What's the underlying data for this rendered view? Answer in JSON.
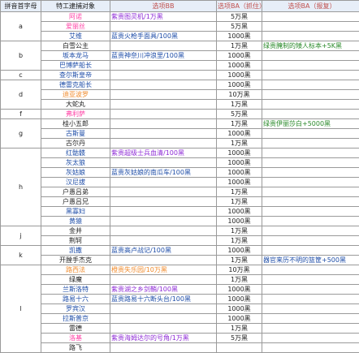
{
  "headers": {
    "letter": "拼音首字母",
    "target": "特工逮捕对象",
    "option_bb": "选项BB",
    "option_ba_catch": "选项BA（抓住）",
    "option_ba_report": "选项BA（报复）"
  },
  "rows": [
    {
      "name": "阿诺",
      "name_color": "pink",
      "bb": "紫贵图灵机/1万黑",
      "bb_color": "purple",
      "ba": "5万黑",
      "bar": "",
      "bar_color": ""
    },
    {
      "name": "爱丽丝",
      "name_color": "pink",
      "bb": "",
      "bb_color": "",
      "ba": "5万黑",
      "bar": "",
      "bar_color": ""
    },
    {
      "name": "艾维",
      "name_color": "blue",
      "bb": "蓝贵火枪手面具/100黑",
      "bb_color": "blue",
      "ba": "1000黑",
      "bar": "",
      "bar_color": ""
    },
    {
      "name": "白雪公主",
      "name_color": "dark",
      "bb": "",
      "bb_color": "",
      "ba": "1万黑",
      "bar": "绿贵腌制的矮人标本+5K黑",
      "bar_color": "green"
    },
    {
      "name": "坂本龙马",
      "name_color": "blue",
      "bb": "蓝贵神奈川冲浪里/100黑",
      "bb_color": "blue",
      "ba": "1000黑",
      "bar": "",
      "bar_color": ""
    },
    {
      "name": "巴博萨船长",
      "name_color": "blue",
      "bb": "",
      "bb_color": "",
      "ba": "1000黑",
      "bar": "",
      "bar_color": ""
    },
    {
      "name": "查尔斯皇帝",
      "name_color": "blue",
      "bb": "",
      "bb_color": "",
      "ba": "1000黑",
      "bar": "",
      "bar_color": ""
    },
    {
      "name": "德雷克船长",
      "name_color": "blue",
      "bb": "",
      "bb_color": "",
      "ba": "1000黑",
      "bar": "",
      "bar_color": ""
    },
    {
      "name": "迪亚波罗",
      "name_color": "orange",
      "bb": "",
      "bb_color": "",
      "ba": "10万黑",
      "bar": "",
      "bar_color": ""
    },
    {
      "name": "大蛇丸",
      "name_color": "dark",
      "bb": "",
      "bb_color": "",
      "ba": "1万黑",
      "bar": "",
      "bar_color": ""
    },
    {
      "name": "弗利萨",
      "name_color": "pink",
      "bb": "",
      "bb_color": "",
      "ba": "5万黑",
      "bar": "",
      "bar_color": ""
    },
    {
      "name": "桂小五郎",
      "name_color": "dark",
      "bb": "",
      "bb_color": "",
      "ba": "1万黑",
      "bar": "绿贵伊丽莎白+5000黑",
      "bar_color": "green"
    },
    {
      "name": "古斯曼",
      "name_color": "blue",
      "bb": "",
      "bb_color": "",
      "ba": "1000黑",
      "bar": "",
      "bar_color": ""
    },
    {
      "name": "古尔丹",
      "name_color": "dark",
      "bb": "",
      "bb_color": "",
      "ba": "1万黑",
      "bar": "",
      "bar_color": ""
    },
    {
      "name": "红骷髅",
      "name_color": "blue",
      "bb": "紫贵超级士兵血清/100黑",
      "bb_color": "purple",
      "ba": "1000黑",
      "bar": "",
      "bar_color": ""
    },
    {
      "name": "灰太狼",
      "name_color": "blue",
      "bb": "",
      "bb_color": "",
      "ba": "1000黑",
      "bar": "",
      "bar_color": ""
    },
    {
      "name": "灰姑娘",
      "name_color": "blue",
      "bb": "蓝贵灰姑娘的南瓜车/100黑",
      "bb_color": "blue",
      "ba": "1000黑",
      "bar": "",
      "bar_color": ""
    },
    {
      "name": "汉尼拔",
      "name_color": "blue",
      "bb": "",
      "bb_color": "",
      "ba": "1000黑",
      "bar": "",
      "bar_color": ""
    },
    {
      "name": "户愚吕弟",
      "name_color": "dark",
      "bb": "",
      "bb_color": "",
      "ba": "1万黑",
      "bar": "",
      "bar_color": ""
    },
    {
      "name": "户愚吕兄",
      "name_color": "dark",
      "bb": "",
      "bb_color": "",
      "ba": "1万黑",
      "bar": "",
      "bar_color": ""
    },
    {
      "name": "黑寡妇",
      "name_color": "blue",
      "bb": "",
      "bb_color": "",
      "ba": "1000黑",
      "bar": "",
      "bar_color": ""
    },
    {
      "name": "黄猿",
      "name_color": "blue",
      "bb": "",
      "bb_color": "",
      "ba": "1000黑",
      "bar": "",
      "bar_color": ""
    },
    {
      "name": "金并",
      "name_color": "dark",
      "bb": "",
      "bb_color": "",
      "ba": "1万黑",
      "bar": "",
      "bar_color": ""
    },
    {
      "name": "荆轲",
      "name_color": "dark",
      "bb": "",
      "bb_color": "",
      "ba": "1万黑",
      "bar": "",
      "bar_color": ""
    },
    {
      "name": "凯撒",
      "name_color": "blue",
      "bb": "蓝贵高卢战记/100黑",
      "bb_color": "blue",
      "ba": "1000黑",
      "bar": "",
      "bar_color": ""
    },
    {
      "name": "开膛手杰克",
      "name_color": "dark",
      "bb": "",
      "bb_color": "",
      "ba": "1万黑",
      "bar": "器官来历不明的篮筐+500黑",
      "bar_color": "blue"
    },
    {
      "name": "路西法",
      "name_color": "orange",
      "bb": "橙贵失乐园/10万黑",
      "bb_color": "orange",
      "ba": "10万黑",
      "bar": "",
      "bar_color": ""
    },
    {
      "name": "绿魔",
      "name_color": "dark",
      "bb": "",
      "bb_color": "",
      "ba": "1万黑",
      "bar": "",
      "bar_color": ""
    },
    {
      "name": "兰斯洛特",
      "name_color": "blue",
      "bb": "紫贵湖之乡剑鞘/100黑",
      "bb_color": "purple",
      "ba": "1000黑",
      "bar": "",
      "bar_color": ""
    },
    {
      "name": "路易十六",
      "name_color": "blue",
      "bb": "蓝贵路易十六断头台/100黑",
      "bb_color": "blue",
      "ba": "1000黑",
      "bar": "",
      "bar_color": ""
    },
    {
      "name": "罗宾汉",
      "name_color": "blue",
      "bb": "",
      "bb_color": "",
      "ba": "1000黑",
      "bar": "",
      "bar_color": ""
    },
    {
      "name": "拉斯普京",
      "name_color": "blue",
      "bb": "",
      "bb_color": "",
      "ba": "1000黑",
      "bar": "",
      "bar_color": ""
    },
    {
      "name": "雷德",
      "name_color": "dark",
      "bb": "",
      "bb_color": "",
      "ba": "1万黑",
      "bar": "",
      "bar_color": ""
    },
    {
      "name": "洛基",
      "name_color": "pink",
      "bb": "紫贵海姆达尔的号角/1万黑",
      "bb_color": "purple",
      "ba": "5万黑",
      "bar": "",
      "bar_color": ""
    },
    {
      "name": "路飞",
      "name_color": "dark",
      "bb": "",
      "bb_color": "",
      "ba": "",
      "bar": "",
      "bar_color": ""
    }
  ],
  "letters": [
    {
      "label": "a",
      "span": 3
    },
    {
      "label": "b",
      "span": 3
    },
    {
      "label": "c",
      "span": 1
    },
    {
      "label": "d",
      "span": 3
    },
    {
      "label": "f",
      "span": 1
    },
    {
      "label": "g",
      "span": 3
    },
    {
      "label": "h",
      "span": 8
    },
    {
      "label": "j",
      "span": 2
    },
    {
      "label": "k",
      "span": 2
    },
    {
      "label": "l",
      "span": 9
    }
  ]
}
